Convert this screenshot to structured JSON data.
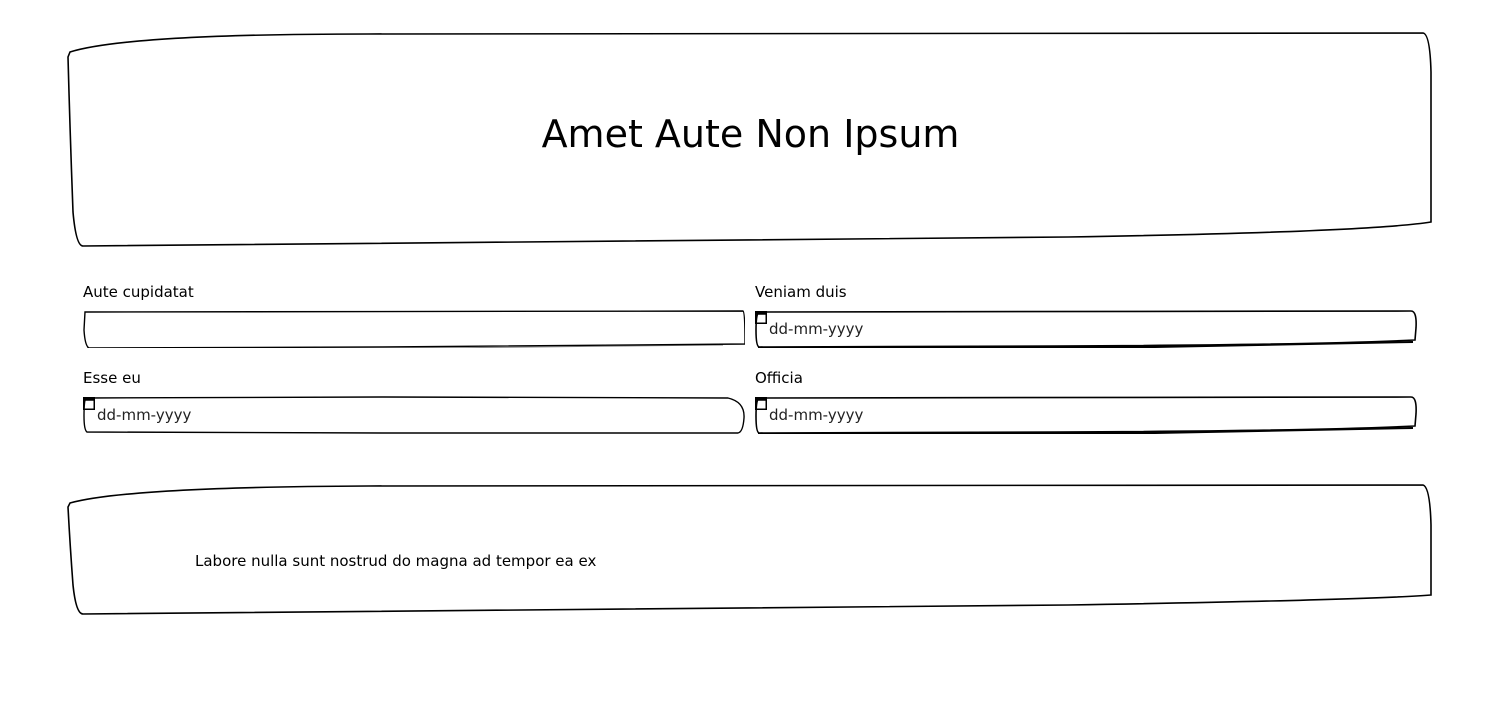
{
  "header": {
    "title": "Amet Aute Non Ipsum"
  },
  "form": {
    "fields": [
      {
        "label": "Aute cupidatat",
        "type": "text",
        "value": ""
      },
      {
        "label": "Veniam duis",
        "type": "date",
        "value": "dd-mm-yyyy",
        "icon": "calendar-icon"
      },
      {
        "label": "Esse eu",
        "type": "date",
        "value": "dd-mm-yyyy",
        "icon": "calendar-icon"
      },
      {
        "label": "Officia",
        "type": "date",
        "value": "dd-mm-yyyy",
        "icon": "calendar-icon"
      }
    ]
  },
  "footer": {
    "text": "Labore nulla sunt nostrud do magna ad tempor ea ex"
  }
}
